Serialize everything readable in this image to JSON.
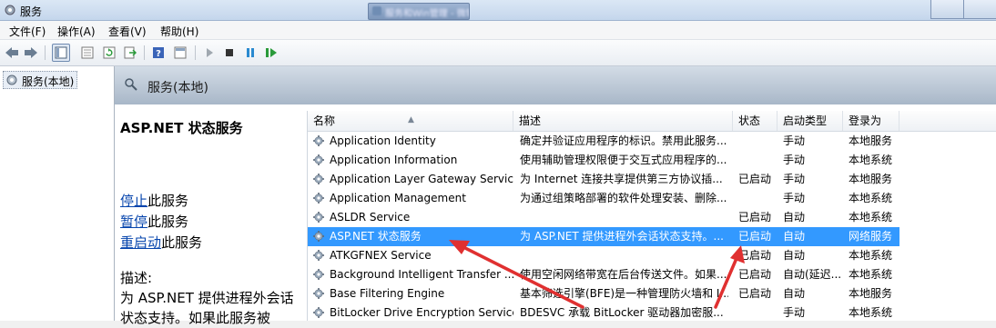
{
  "window": {
    "title": "服务",
    "taskbar_tab": "服务和Win管理 - 微软雅黑"
  },
  "menu": [
    {
      "label": "文件(F)"
    },
    {
      "label": "操作(A)"
    },
    {
      "label": "查看(V)"
    },
    {
      "label": "帮助(H)"
    }
  ],
  "tree": {
    "node_label": "服务(本地)"
  },
  "panel": {
    "header": "服务(本地)"
  },
  "details": {
    "service_name": "ASP.NET 状态服务",
    "actions": [
      {
        "link": "停止",
        "rest": "此服务"
      },
      {
        "link": "暂停",
        "rest": "此服务"
      },
      {
        "link": "重启动",
        "rest": "此服务"
      }
    ],
    "desc_label": "描述:",
    "desc_text": "为 ASP.NET 提供进程外会话状态支持。如果此服务被"
  },
  "columns": {
    "name": "名称",
    "desc": "描述",
    "status": "状态",
    "startup": "启动类型",
    "logon": "登录为"
  },
  "services": [
    {
      "name": "Application Identity",
      "desc": "确定并验证应用程序的标识。禁用此服务...",
      "status": "",
      "startup": "手动",
      "logon": "本地服务"
    },
    {
      "name": "Application Information",
      "desc": "使用辅助管理权限便于交互式应用程序的...",
      "status": "",
      "startup": "手动",
      "logon": "本地系统"
    },
    {
      "name": "Application Layer Gateway Service",
      "desc": "为 Internet 连接共享提供第三方协议插...",
      "status": "已启动",
      "startup": "手动",
      "logon": "本地服务"
    },
    {
      "name": "Application Management",
      "desc": "为通过组策略部署的软件处理安装、删除...",
      "status": "",
      "startup": "手动",
      "logon": "本地系统"
    },
    {
      "name": "ASLDR Service",
      "desc": "",
      "status": "已启动",
      "startup": "自动",
      "logon": "本地系统"
    },
    {
      "name": "ASP.NET 状态服务",
      "desc": "为 ASP.NET 提供进程外会话状态支持。...",
      "status": "已启动",
      "startup": "自动",
      "logon": "网络服务",
      "selected": true
    },
    {
      "name": "ATKGFNEX Service",
      "desc": "",
      "status": "已启动",
      "startup": "自动",
      "logon": "本地系统"
    },
    {
      "name": "Background Intelligent Transfer ...",
      "desc": "使用空闲网络带宽在后台传送文件。如果...",
      "status": "已启动",
      "startup": "自动(延迟...",
      "logon": "本地系统"
    },
    {
      "name": "Base Filtering Engine",
      "desc": "基本筛选引擎(BFE)是一种管理防火墙和 I...",
      "status": "已启动",
      "startup": "自动",
      "logon": "本地服务"
    },
    {
      "name": "BitLocker Drive Encryption Service",
      "desc": "BDESVC 承载 BitLocker 驱动器加密服...",
      "status": "",
      "startup": "手动",
      "logon": "本地系统"
    }
  ],
  "icons": [
    "back-icon",
    "forward-icon",
    "console-tree-icon",
    "properties-icon",
    "refresh-icon",
    "export-icon",
    "help-icon",
    "view-icon",
    "start-icon",
    "stop-icon",
    "pause-icon",
    "resume-icon",
    "gear-icon"
  ],
  "colors": {
    "selection": "#3399ff",
    "annotation_arrow": "#e03030",
    "link": "#0645ad"
  }
}
